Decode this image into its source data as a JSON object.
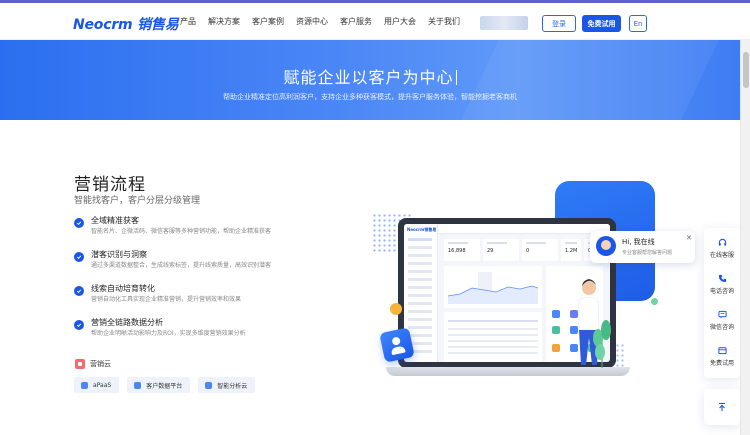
{
  "header": {
    "logo": "Neocrm 销售易",
    "nav": [
      "产品",
      "解决方案",
      "客户案例",
      "资源中心",
      "客户服务",
      "用户大会",
      "关于我们"
    ],
    "login_label": "登录",
    "trial_label": "免费试用",
    "lang_label": "En"
  },
  "hero": {
    "title": "赋能企业以客户为中心",
    "subtitle": "帮助企业精准定位高利润客户，支持企业多种获客模式，提升客户服务体验，智能挖掘老客商机"
  },
  "section": {
    "title": "营销流程",
    "subtitle": "智能找客户，客户分层分级管理",
    "features": [
      {
        "title": "全域精准获客",
        "desc": "智能名片、企微活码、微信客服等多种营销功能，帮助企业精准获客"
      },
      {
        "title": "潜客识别与洞察",
        "desc": "通过多渠道数据整合，生成线索标签，提升线索质量，高效识别潜客"
      },
      {
        "title": "线索自动培育转化",
        "desc": "营销自动化工具实现企业精准营销，提升营销效率和效果"
      },
      {
        "title": "营销全链路数据分析",
        "desc": "帮助企业明晰活动影响力及ROI，实现多维度营销效果分析"
      }
    ],
    "cloud_name": "营销云",
    "tags": [
      "aPaaS",
      "客户数据平台",
      "智能分析云"
    ]
  },
  "illustration": {
    "app_logo": "Neocrm销售易",
    "stat_values": [
      "16,898",
      "29",
      "0",
      "1.2M",
      "0"
    ],
    "chat_greeting": "Hi, 我在线",
    "chat_sub": "专业客服帮您解答问题"
  },
  "float_bar": {
    "items": [
      {
        "icon": "headset-icon",
        "label": "在线客服"
      },
      {
        "icon": "phone-icon",
        "label": "电话咨询"
      },
      {
        "icon": "wechat-icon",
        "label": "微信咨询"
      },
      {
        "icon": "trial-icon",
        "label": "免费试用"
      }
    ],
    "back_top_icon": "arrow-up-icon"
  },
  "colors": {
    "brand": "#1a56e8",
    "hero_start": "#2b6ff0",
    "hero_end": "#5f99f8"
  }
}
